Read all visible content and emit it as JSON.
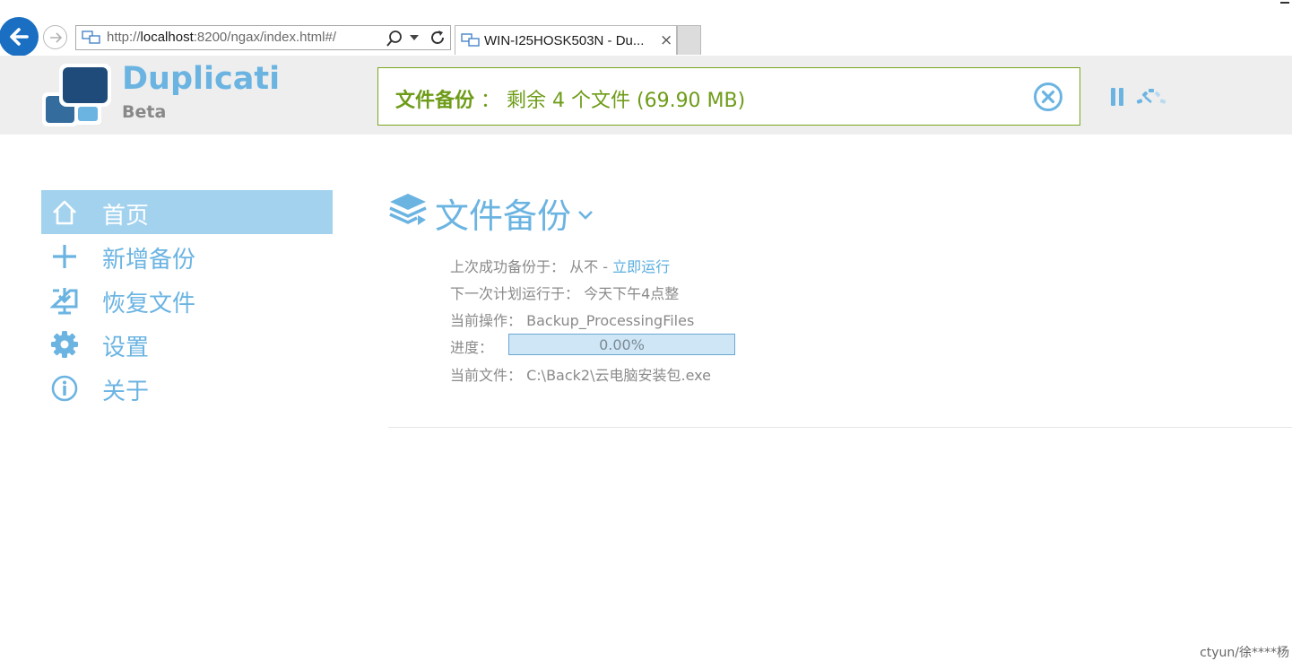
{
  "browser": {
    "url_prefix": "http://",
    "url_host": "localhost",
    "url_rest": ":8200/ngax/index.html#/",
    "tab_title": "WIN-I25HOSK503N - Du...",
    "tab_close": "×"
  },
  "header": {
    "brand": "Duplicati",
    "brand_sub": "Beta",
    "status_task": "文件备份",
    "status_sep": " ： ",
    "status_detail": "剩余 4 个文件 (69.90 MB)"
  },
  "sidebar": {
    "items": [
      {
        "label": "首页",
        "icon": "home-icon",
        "active": true
      },
      {
        "label": "新增备份",
        "icon": "plus-icon",
        "active": false
      },
      {
        "label": "恢复文件",
        "icon": "restore-icon",
        "active": false
      },
      {
        "label": "设置",
        "icon": "gear-icon",
        "active": false
      },
      {
        "label": "关于",
        "icon": "info-icon",
        "active": false
      }
    ]
  },
  "task": {
    "title": "文件备份",
    "last_success_label": "上次成功备份于：",
    "last_success_value": "从不 - ",
    "run_now_link": "立即运行",
    "next_run_label": "下一次计划运行于：",
    "next_run_value": "今天下午4点整",
    "current_op_label": "当前操作：",
    "current_op_value": "Backup_ProcessingFiles",
    "progress_label": "进度：",
    "progress": 0.0,
    "progress_text": "0.00%",
    "current_file_label": "当前文件：",
    "current_file_value": "C:\\Back2\\云电脑安装包.exe"
  },
  "colors": {
    "accent": "#6bb4e2",
    "status_green": "#6e9c18",
    "active_nav": "#a2d2ee",
    "header_bg": "#eeeeee"
  },
  "watermark": "ctyun/徐****杨"
}
